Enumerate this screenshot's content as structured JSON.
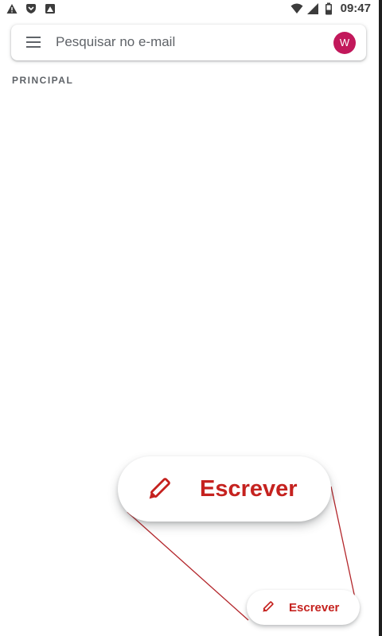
{
  "status_bar": {
    "left_icons": [
      "alert-triangle-icon",
      "shield-icon",
      "image-icon"
    ],
    "right_icons": [
      "wifi-icon",
      "signal-icon",
      "battery-icon"
    ],
    "time": "09:47"
  },
  "search": {
    "placeholder": "Pesquisar no e-mail",
    "avatar_initial": "W",
    "avatar_color": "#c2185b"
  },
  "inbox": {
    "section_label": "PRINCIPAL"
  },
  "compose_zoomed": {
    "label": "Escrever",
    "icon": "pencil-icon"
  },
  "compose": {
    "label": "Escrever",
    "icon": "pencil-icon"
  },
  "colors": {
    "accent": "#c5221f",
    "connector": "#b3262b"
  }
}
